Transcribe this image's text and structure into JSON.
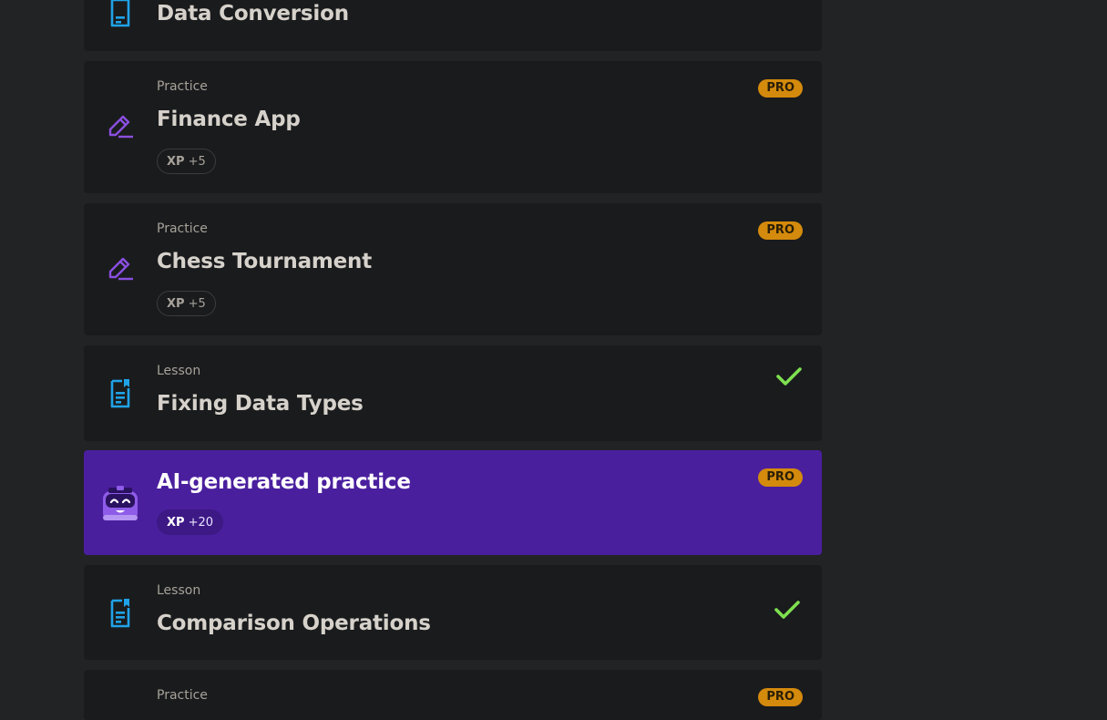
{
  "items": [
    {
      "type": "",
      "title": "Data Conversion",
      "icon": "lesson-doc-icon"
    },
    {
      "type": "Practice",
      "title": "Finance App",
      "xp_label": "XP",
      "xp_value": "+5",
      "badge": "PRO",
      "icon": "pencil-icon"
    },
    {
      "type": "Practice",
      "title": "Chess Tournament",
      "xp_label": "XP",
      "xp_value": "+5",
      "badge": "PRO",
      "icon": "pencil-icon"
    },
    {
      "type": "Lesson",
      "title": "Fixing Data Types",
      "icon": "lesson-doc-icon",
      "status": "completed"
    },
    {
      "type": "",
      "title": "AI-generated practice",
      "xp_label": "XP",
      "xp_value": "+20",
      "badge": "PRO",
      "icon": "bot-mascot-icon"
    },
    {
      "type": "Lesson",
      "title": "Comparison Operations",
      "icon": "lesson-doc-icon",
      "status": "completed"
    },
    {
      "type": "Practice",
      "title": "",
      "badge": "PRO",
      "icon": "pencil-icon"
    }
  ],
  "colors": {
    "background": "#222325",
    "card": "#1a1b1d",
    "ai_card": "#4a1f9e",
    "pro_badge": "#d48a0c",
    "check": "#7ee04f",
    "lesson_icon": "#1fa3e8",
    "practice_icon": "#8a4fe0"
  }
}
